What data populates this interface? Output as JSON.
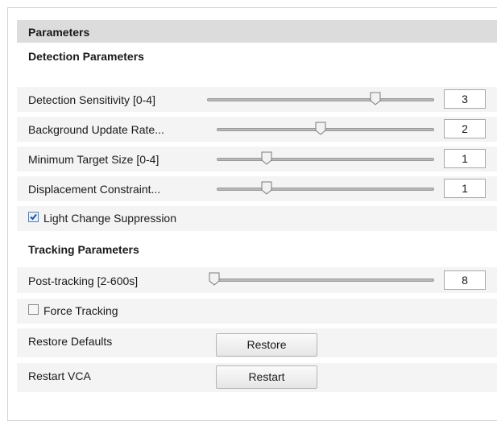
{
  "panel": {
    "title": "Parameters",
    "detection": {
      "heading": "Detection Parameters",
      "sliders": [
        {
          "label": "Detection Sensitivity [0-4]",
          "value": "3",
          "min": 0,
          "max": 4
        },
        {
          "label": "Background Update Rate...",
          "value": "2",
          "min": 0,
          "max": 4
        },
        {
          "label": "Minimum Target Size [0-4]",
          "value": "1",
          "min": 0,
          "max": 4
        },
        {
          "label": "Displacement Constraint...",
          "value": "1",
          "min": 0,
          "max": 4
        }
      ],
      "light_change": {
        "label": "Light Change Suppression",
        "checked": true
      }
    },
    "tracking": {
      "heading": "Tracking Parameters",
      "post_tracking": {
        "label": "Post-tracking [2-600s]",
        "value": "8",
        "min": 2,
        "max": 600
      },
      "force_tracking": {
        "label": "Force Tracking",
        "checked": false
      }
    },
    "restore": {
      "label": "Restore Defaults",
      "button": "Restore"
    },
    "restart": {
      "label": "Restart VCA",
      "button": "Restart"
    }
  }
}
